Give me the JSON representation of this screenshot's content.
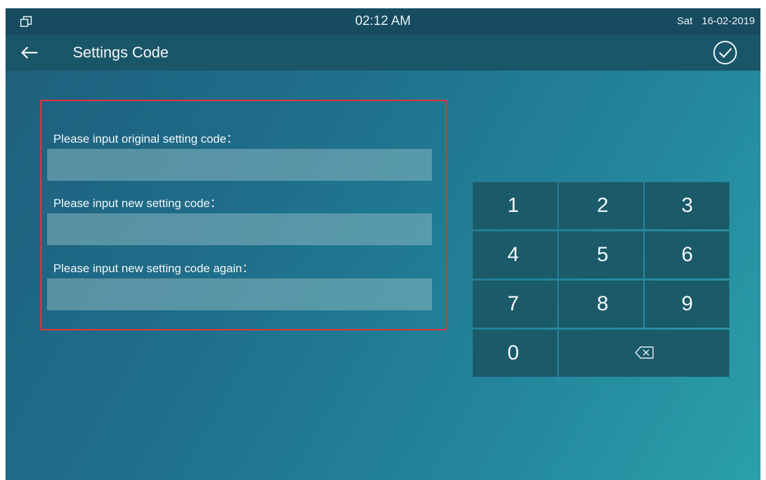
{
  "status_bar": {
    "time": "02:12 AM",
    "day": "Sat",
    "date": "16-02-2019",
    "left_icon": "window-restore-icon"
  },
  "title_bar": {
    "title": "Settings Code",
    "back_icon": "arrow-left-icon",
    "confirm_icon": "check-circle-icon"
  },
  "form": {
    "fields": [
      {
        "label": "Please input original setting code：",
        "value": ""
      },
      {
        "label": "Please input new setting code：",
        "value": ""
      },
      {
        "label": "Please input new setting code again：",
        "value": ""
      }
    ]
  },
  "keypad": {
    "keys": [
      "1",
      "2",
      "3",
      "4",
      "5",
      "6",
      "7",
      "8",
      "9",
      "0"
    ],
    "backspace_icon": "backspace-icon"
  },
  "colors": {
    "highlight_border": "#e0333a",
    "status_bar_bg": "#174b5f",
    "key_bg": "#1b5a69"
  }
}
